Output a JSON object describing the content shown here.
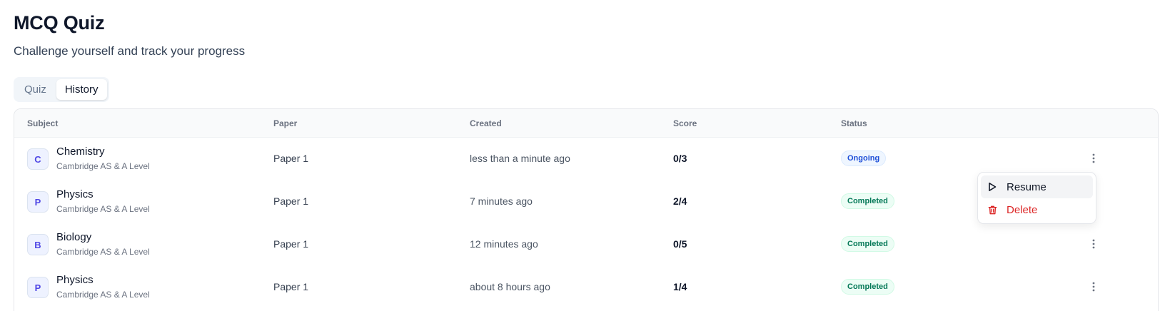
{
  "header": {
    "title": "MCQ Quiz",
    "subtitle": "Challenge yourself and track your progress"
  },
  "tabs": [
    {
      "label": "Quiz",
      "active": false
    },
    {
      "label": "History",
      "active": true
    }
  ],
  "table": {
    "columns": [
      "Subject",
      "Paper",
      "Created",
      "Score",
      "Status"
    ],
    "rows": [
      {
        "initial": "C",
        "subject": "Chemistry",
        "board": "Cambridge AS & A Level",
        "paper": "Paper 1",
        "created": "less than a minute ago",
        "score": "0/3",
        "status": "Ongoing"
      },
      {
        "initial": "P",
        "subject": "Physics",
        "board": "Cambridge AS & A Level",
        "paper": "Paper 1",
        "created": "7 minutes ago",
        "score": "2/4",
        "status": "Completed"
      },
      {
        "initial": "B",
        "subject": "Biology",
        "board": "Cambridge AS & A Level",
        "paper": "Paper 1",
        "created": "12 minutes ago",
        "score": "0/5",
        "status": "Completed"
      },
      {
        "initial": "P",
        "subject": "Physics",
        "board": "Cambridge AS & A Level",
        "paper": "Paper 1",
        "created": "about 8 hours ago",
        "score": "1/4",
        "status": "Completed"
      }
    ]
  },
  "context_menu": {
    "items": [
      {
        "label": "Resume",
        "icon": "play-icon"
      },
      {
        "label": "Delete",
        "icon": "trash-icon"
      }
    ]
  },
  "colors": {
    "ongoing": "#1d4ed8",
    "completed": "#047857",
    "danger": "#dc2626"
  }
}
